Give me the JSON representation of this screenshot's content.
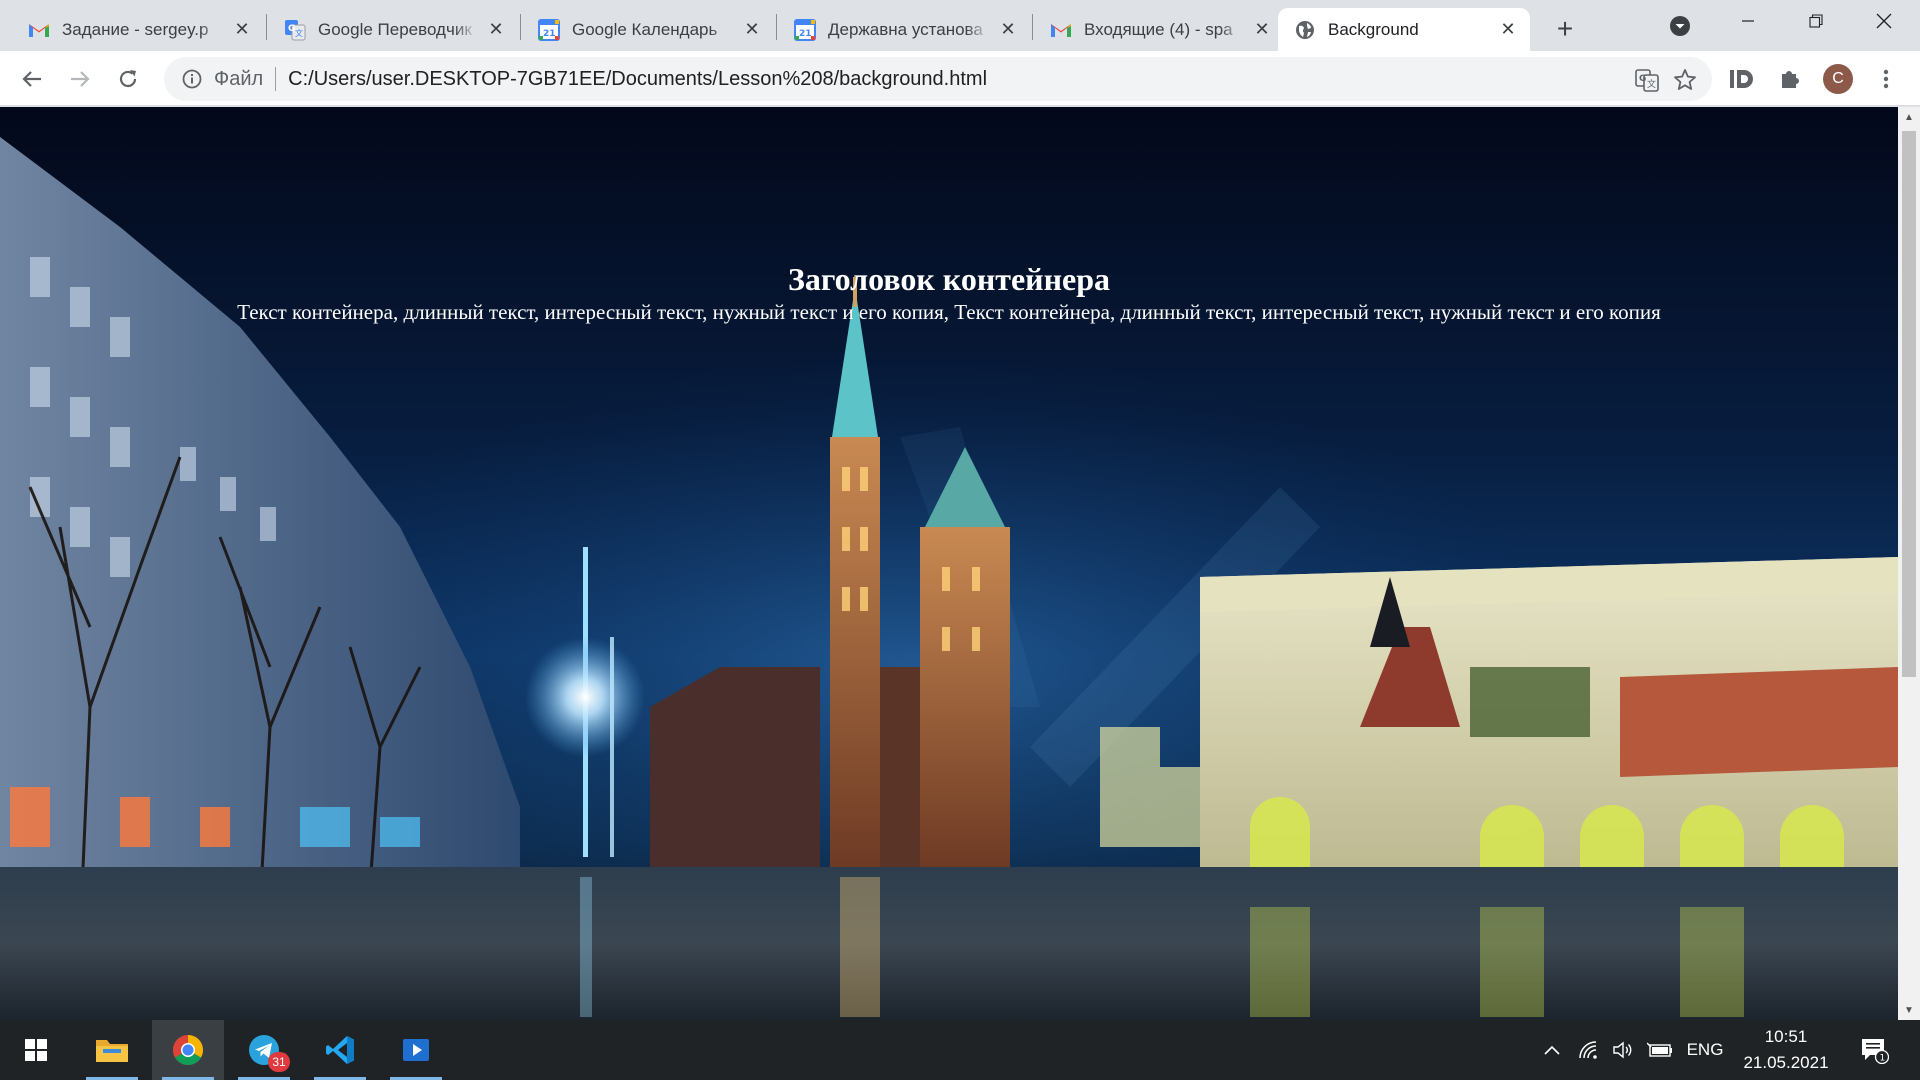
{
  "browser": {
    "tabs": [
      {
        "title": "Задание - sergey.p",
        "icon": "gmail-icon",
        "active": false
      },
      {
        "title": "Google Переводчик",
        "icon": "google-translate-icon",
        "active": false
      },
      {
        "title": "Google Календарь",
        "icon": "google-calendar-icon",
        "calendar_day": "21",
        "active": false
      },
      {
        "title": "Державна установа",
        "icon": "google-calendar-icon",
        "calendar_day": "21",
        "active": false
      },
      {
        "title": "Входящие (4) - spa",
        "icon": "gmail-icon",
        "active": false
      },
      {
        "title": "Background",
        "icon": "globe-icon",
        "active": true
      }
    ],
    "new_tab_label": "+",
    "address_bar": {
      "scheme_chip": "Файл",
      "url": "C:/Users/user.DESKTOP-7GB71EE/Documents/Lesson%208/background.html"
    },
    "profile_initial": "C"
  },
  "page": {
    "heading": "Заголовок контейнера",
    "body_text": "Текст контейнера, длинный текст, интересный текст, нужный текст и его копия, Текст контейнера, длинный текст, интересный текст, нужный текст и его копия"
  },
  "taskbar": {
    "apps": [
      {
        "name": "start-button",
        "icon": "windows-logo-icon"
      },
      {
        "name": "file-explorer",
        "icon": "folder-icon",
        "running": true
      },
      {
        "name": "chrome",
        "icon": "chrome-icon",
        "running": true,
        "active": true
      },
      {
        "name": "telegram",
        "icon": "telegram-icon",
        "badge": "31",
        "running": true
      },
      {
        "name": "vscode",
        "icon": "vscode-icon",
        "running": true
      },
      {
        "name": "media-player",
        "icon": "media-player-icon",
        "running": true
      }
    ],
    "tray": {
      "language": "ENG",
      "time": "10:51",
      "date": "21.05.2021",
      "notification_count": "1"
    }
  },
  "colors": {
    "tabstrip": "#dee1e6",
    "gmail_red": "#ea4335",
    "google_blue": "#4285f4",
    "taskbar": "#1f2326"
  }
}
